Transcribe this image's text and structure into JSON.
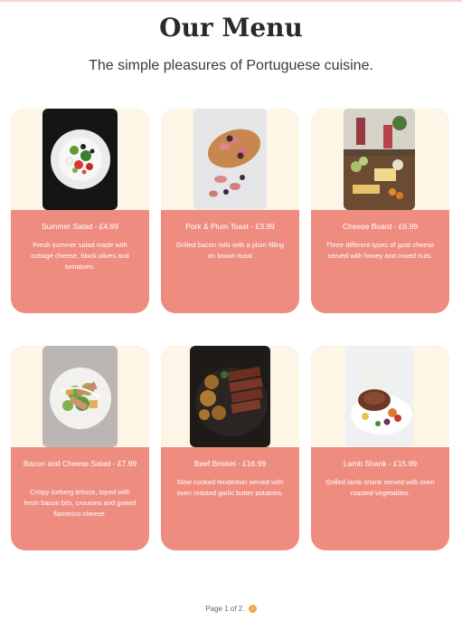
{
  "header": {
    "title": "Our Menu",
    "subtitle": "The simple pleasures of Portuguese cuisine."
  },
  "menu": {
    "items": [
      {
        "name": "Summer Salad - £4.99",
        "description": "Fresh summer salad made with cottage cheese, black olives and tomatoes.",
        "image": "salad-photo"
      },
      {
        "name": "Pork & Plum Toast - £3.99",
        "description": "Grilled bacon rolls with a plum filling on brown toast",
        "image": "toast-photo"
      },
      {
        "name": "Cheese Board - £6.99",
        "description": "Three different types of goat cheese served with honey and mixed nuts.",
        "image": "cheese-board-photo"
      },
      {
        "name": "Bacon and Cheese Salad - £7.99",
        "description": "Crispy iceberg lettuce, toped with fresh bacon bits, croutons and grated flamenco cheese.",
        "image": "bacon-salad-photo"
      },
      {
        "name": "Beef Brisket - £16.99",
        "description": "Slow cooked tenderloin served with oven roasted garlic butter potatoes.",
        "image": "brisket-photo"
      },
      {
        "name": "Lamb Shank - £15.99",
        "description": "Grilled lamb shank served with oven roasted vegetables.",
        "image": "lamb-shank-photo"
      }
    ]
  },
  "pagination": {
    "label": "Page 1 of 2.",
    "next_icon": "›"
  },
  "colors": {
    "card": "#ef8c80",
    "card_top": "#fdf5e6",
    "accent": "#f3a64a"
  }
}
